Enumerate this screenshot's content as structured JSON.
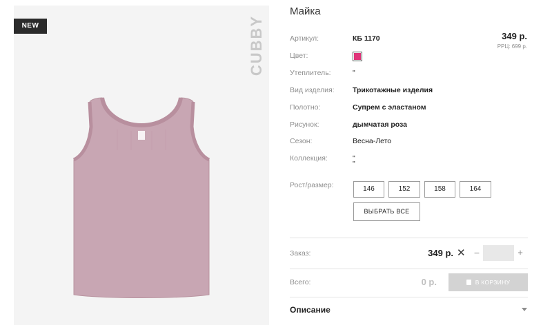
{
  "product": {
    "badge": "NEW",
    "brand": "CUBBY",
    "title": "Майка",
    "price": "349 р.",
    "rrp": "РРЦ: 699 р."
  },
  "attributes": [
    {
      "label": "Артикул:",
      "value": "КБ 1170"
    },
    {
      "label": "Цвет:",
      "value": "",
      "color": "#e0357a"
    },
    {
      "label": "Утеплитель:",
      "value": "\""
    },
    {
      "label": "Вид изделия:",
      "value": "Трикотажные изделия"
    },
    {
      "label": "Полотно:",
      "value": "Супрем с эластаном"
    },
    {
      "label": "Рисунок:",
      "value": "дымчатая роза"
    },
    {
      "label": "Сезон:",
      "value": "Весна-Лето"
    },
    {
      "label": "Коллекция:",
      "value": "\"",
      "value2": "\""
    }
  ],
  "sizes": {
    "label": "Рост/размер:",
    "options": [
      "146",
      "152",
      "158",
      "164"
    ],
    "select_all": "ВЫБРАТЬ ВСЕ"
  },
  "order": {
    "label": "Заказ:",
    "price": "349 р.",
    "times_symbol": "✕",
    "minus": "−",
    "quantity": "",
    "plus": "+"
  },
  "total": {
    "label": "Всего:",
    "value": "0 р.",
    "cart_button": "В КОРЗИНУ"
  },
  "description": {
    "label": "Описание"
  },
  "colors": {
    "garment": "#c8a6b3",
    "swatch": "#e0357a"
  }
}
